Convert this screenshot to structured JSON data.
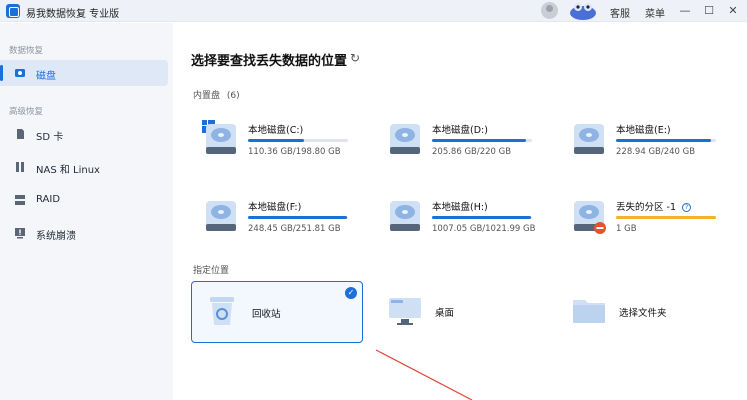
{
  "app": {
    "title": "易我数据恢复 专业版"
  },
  "titlebar": {
    "support_label": "客服",
    "menu_label": "菜单",
    "minimize": "—",
    "maximize": "☐",
    "close": "✕"
  },
  "sidebar": {
    "sections": [
      {
        "label": "数据恢复"
      },
      {
        "label": "高级恢复"
      }
    ],
    "items": [
      {
        "label": "磁盘",
        "icon": "disk-icon"
      },
      {
        "label": "SD 卡",
        "icon": "sd-card-icon"
      },
      {
        "label": "NAS 和 Linux",
        "icon": "nas-icon"
      },
      {
        "label": "RAID",
        "icon": "raid-icon"
      },
      {
        "label": "系统崩溃",
        "icon": "system-crash-icon"
      }
    ]
  },
  "main": {
    "title": "选择要查找丢失数据的位置",
    "refresh_icon": "↻",
    "internal_label": "内置盘",
    "internal_count": "(6)",
    "specified_label": "指定位置"
  },
  "drives": [
    {
      "name": "本地磁盘(C:)",
      "size": "110.36 GB/198.80 GB",
      "used": 0.555
    },
    {
      "name": "本地磁盘(D:)",
      "size": "205.86 GB/220 GB",
      "used": 0.936
    },
    {
      "name": "本地磁盘(E:)",
      "size": "228.94 GB/240 GB",
      "used": 0.954
    },
    {
      "name": "本地磁盘(F:)",
      "size": "248.45 GB/251.81 GB",
      "used": 0.987
    },
    {
      "name": "本地磁盘(H:)",
      "size": "1007.05 GB/1021.99 GB",
      "used": 0.985
    },
    {
      "name": "丢失的分区 -1",
      "size": "1 GB",
      "used": 1.0
    }
  ],
  "locations": [
    {
      "name": "回收站",
      "icon": "recycle-bin-icon",
      "selected": true,
      "check": "✓"
    },
    {
      "name": "桌面",
      "icon": "desktop-icon",
      "selected": false
    },
    {
      "name": "选择文件夹",
      "icon": "folder-icon",
      "selected": false
    }
  ],
  "colors": {
    "accent": "#1c6fd9",
    "warning": "#f0b429",
    "lost": "#e5532d"
  }
}
